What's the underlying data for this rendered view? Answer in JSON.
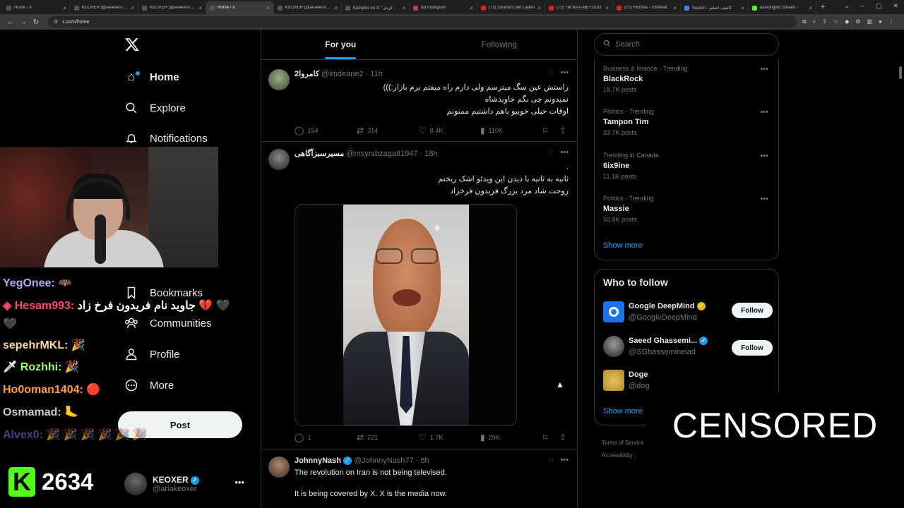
{
  "browser": {
    "tabs": [
      {
        "label": "Home / X",
        "active": false
      },
      {
        "label": "KEOXER (@ariakeoxer) / X",
        "active": false
      },
      {
        "label": "KEOXER (@ariakeoxer) / X",
        "active": false
      },
      {
        "label": "Home / X",
        "active": true
      },
      {
        "label": "KEOXER (@ariakeoxer) / X",
        "active": false
      },
      {
        "label": "Kämpfer on X: \"کردی -",
        "active": false
      },
      {
        "label": "(9) Instagram",
        "active": false
      },
      {
        "label": "(75) Obama's Bin Laden",
        "active": false
      },
      {
        "label": "(75) TM BAX-MEYDOO",
        "active": false
      },
      {
        "label": "(75) Hichkas - Ekhtelaf",
        "active": false
      },
      {
        "label": "Search - کاشف اعظم",
        "active": false
      },
      {
        "label": "asmongold Stream -",
        "active": false
      }
    ],
    "url": "x.com/home"
  },
  "nav": {
    "home": "Home",
    "explore": "Explore",
    "notifications": "Notifications",
    "bookmarks": "Bookmarks",
    "communities": "Communities",
    "profile": "Profile",
    "more": "More",
    "post": "Post"
  },
  "account": {
    "name": "KEOXER",
    "handle": "@ariakeoxer"
  },
  "chat": [
    {
      "user": "YegOnee:",
      "color": "#b9a4f5",
      "msg": ""
    },
    {
      "user": "◈ Hesam993:",
      "color": "#ff4a6e",
      "msg": "جاوید نام فریدون فرخ زاد 💔"
    },
    {
      "user": "sepehrMKL:",
      "color": "#ffd7a0",
      "msg": ""
    },
    {
      "user": "Rozhhi:",
      "color": "#9bff6b",
      "msg": ""
    },
    {
      "user": "Ho0oman1404:",
      "color": "#ff9f2e",
      "msg": ""
    },
    {
      "user": "Osmamad:",
      "color": "#c9c9c9",
      "msg": ""
    },
    {
      "user": "Alvex0:",
      "color": "#7a6bd4",
      "msg": ""
    }
  ],
  "viewer_count": "2634",
  "feed": {
    "tabs": [
      "For you",
      "Following"
    ],
    "tweets": [
      {
        "name": "کامروا2",
        "handle": "@imdearie2",
        "time": "11h",
        "lines": [
          "راستش عین سگ میترسم ولی دارم راه میفتم برم بازار:)))",
          "نمیدونم چی بگم جاویدشاه",
          "اوقات خیلی خوبیو باهم داشتیم ممنونم"
        ],
        "replies": "154",
        "reposts": "314",
        "likes": "8.4K",
        "views": "110K"
      },
      {
        "name": "مسیرسبزآگاهی",
        "handle": "@msyrsbzaga81947",
        "time": "18h",
        "lines": [
          ".",
          "ثانیه به ثانیه با دیدن این ویدئو اشک ریختم",
          "روحت شاد مرد بزرگ فریدون فرخزاد"
        ],
        "replies": "1",
        "reposts": "221",
        "likes": "1.7K",
        "views": "29K"
      },
      {
        "name": "JohnnyNash",
        "handle": "@JohnnyNash77",
        "time": "6h",
        "lines": [
          "The revolution on Iran is not being televised.",
          "",
          "It is being covered by X. X is the media now."
        ],
        "replies": "",
        "reposts": "",
        "likes": "",
        "views": ""
      }
    ]
  },
  "search": {
    "placeholder": "Search"
  },
  "trends": [
    {
      "context": "Business & finance · Trending",
      "name": "BlackRock",
      "count": "18.7K posts"
    },
    {
      "context": "Politics · Trending",
      "name": "Tampon Tim",
      "count": "23.7K posts"
    },
    {
      "context": "Trending in Canada",
      "name": "6ix9ine",
      "count": "11.1K posts"
    },
    {
      "context": "Politics · Trending",
      "name": "Massie",
      "count": "50.9K posts"
    }
  ],
  "trends_show_more": "Show more",
  "who_to_follow": {
    "title": "Who to follow",
    "accounts": [
      {
        "name": "Google DeepMind",
        "handle": "@GoogleDeepMind",
        "follow": "Follow"
      },
      {
        "name": "Saeed Ghassemi...",
        "handle": "@SGhassemineiad",
        "follow": "Follow"
      },
      {
        "name": "Doge",
        "handle": "@dog",
        "follow": ""
      }
    ],
    "show_more": "Show more"
  },
  "footer": {
    "terms": "Terms of Service",
    "accessibility": "Accessibility"
  },
  "overlay": {
    "censored": "CENSORED"
  },
  "colors": {
    "accent": "#1d9bf0",
    "background": "#000000",
    "border": "#2f3336",
    "muted": "#71767b",
    "kick_green": "#53fc18"
  }
}
